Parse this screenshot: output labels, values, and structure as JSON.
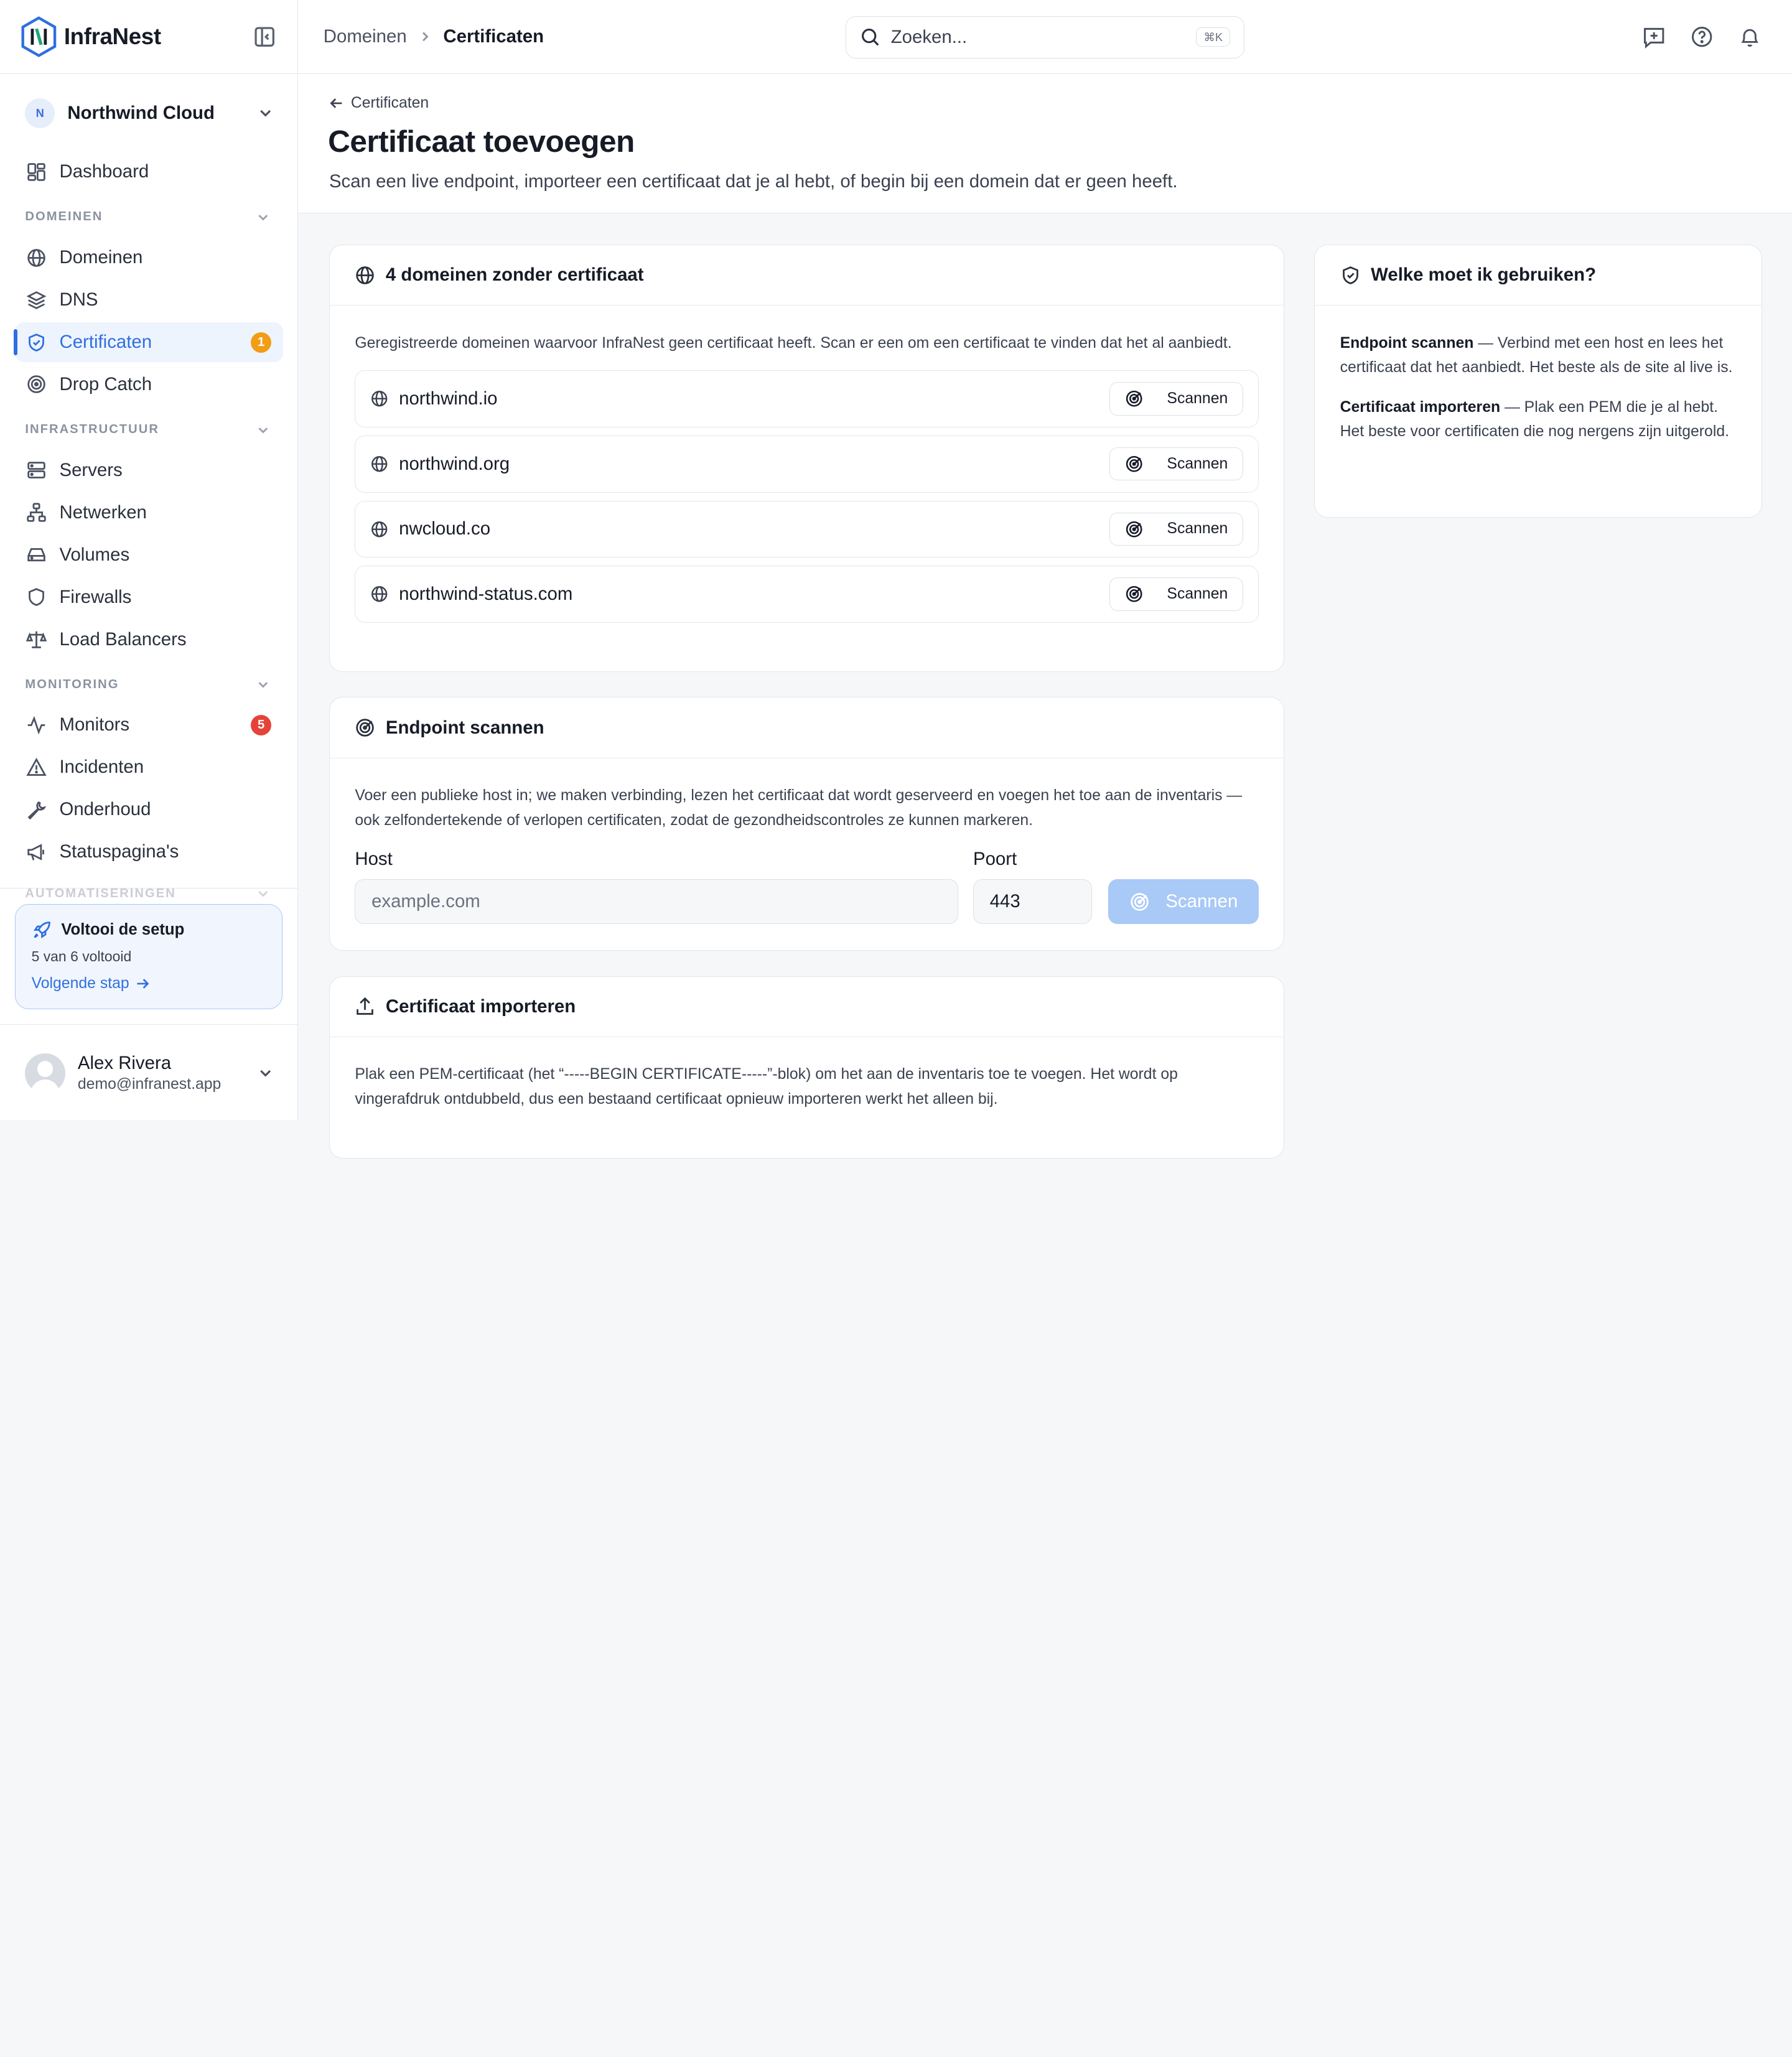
{
  "brand": {
    "name": "InfraNest"
  },
  "org": {
    "initial": "N",
    "name": "Northwind Cloud"
  },
  "sidebar": {
    "dashboard": "Dashboard",
    "sections": [
      {
        "label": "DOMEINEN",
        "items": [
          {
            "label": "Domeinen"
          },
          {
            "label": "DNS"
          },
          {
            "label": "Certificaten",
            "badge": "1"
          },
          {
            "label": "Drop Catch"
          }
        ]
      },
      {
        "label": "INFRASTRUCTUUR",
        "items": [
          {
            "label": "Servers"
          },
          {
            "label": "Netwerken"
          },
          {
            "label": "Volumes"
          },
          {
            "label": "Firewalls"
          },
          {
            "label": "Load Balancers"
          }
        ]
      },
      {
        "label": "MONITORING",
        "items": [
          {
            "label": "Monitors",
            "badge": "5"
          },
          {
            "label": "Incidenten"
          },
          {
            "label": "Onderhoud"
          },
          {
            "label": "Statuspagina's"
          }
        ]
      },
      {
        "label": "AUTOMATISERINGEN"
      }
    ]
  },
  "setup": {
    "title": "Voltooi de setup",
    "progress": "5 van 6 voltooid",
    "next": "Volgende stap"
  },
  "user": {
    "name": "Alex Rivera",
    "email": "demo@infranest.app"
  },
  "topbar": {
    "breadcrumb": [
      "Domeinen",
      "Certificaten"
    ],
    "search_placeholder": "Zoeken...",
    "search_shortcut": "⌘K"
  },
  "header": {
    "back_label": "Certificaten",
    "title": "Certificaat toevoegen",
    "subtitle": "Scan een live endpoint, importeer een certificaat dat je al hebt, of begin bij een domein dat er geen heeft."
  },
  "no_cert": {
    "title": "4 domeinen zonder certificaat",
    "description": "Geregistreerde domeinen waarvoor InfraNest geen certificaat heeft. Scan er een om een certificaat te vinden dat het al aanbiedt.",
    "scan_label": "Scannen",
    "domains": [
      "northwind.io",
      "northwind.org",
      "nwcloud.co",
      "northwind-status.com"
    ]
  },
  "endpoint": {
    "title": "Endpoint scannen",
    "description": "Voer een publieke host in; we maken verbinding, lezen het certificaat dat wordt geserveerd en voegen het toe aan de inventaris — ook zelfondertekende of verlopen certificaten, zodat de gezondheidscontroles ze kunnen markeren.",
    "host_label": "Host",
    "host_placeholder": "example.com",
    "port_label": "Poort",
    "port_value": "443",
    "submit_label": "Scannen"
  },
  "import": {
    "title": "Certificaat importeren",
    "description": "Plak een PEM-certificaat (het “-----BEGIN CERTIFICATE-----”-blok) om het aan de inventaris toe te voegen. Het wordt op vingerafdruk ontdubbeld, dus een bestaand certificaat opnieuw importeren werkt het alleen bij."
  },
  "help": {
    "title": "Welke moet ik gebruiken?",
    "items": [
      {
        "term": "Endpoint scannen",
        "text": " — Verbind met een host en lees het certificaat dat het aanbiedt. Het beste als de site al live is."
      },
      {
        "term": "Certificaat importeren",
        "text": " — Plak een PEM die je al hebt. Het beste voor certificaten die nog nergens zijn uitgerold."
      }
    ]
  },
  "colors": {
    "accent": "#2f6fe0",
    "badge_orange": "#f29d16",
    "badge_red": "#e5433a",
    "button_disabled": "#a9c9f6"
  }
}
